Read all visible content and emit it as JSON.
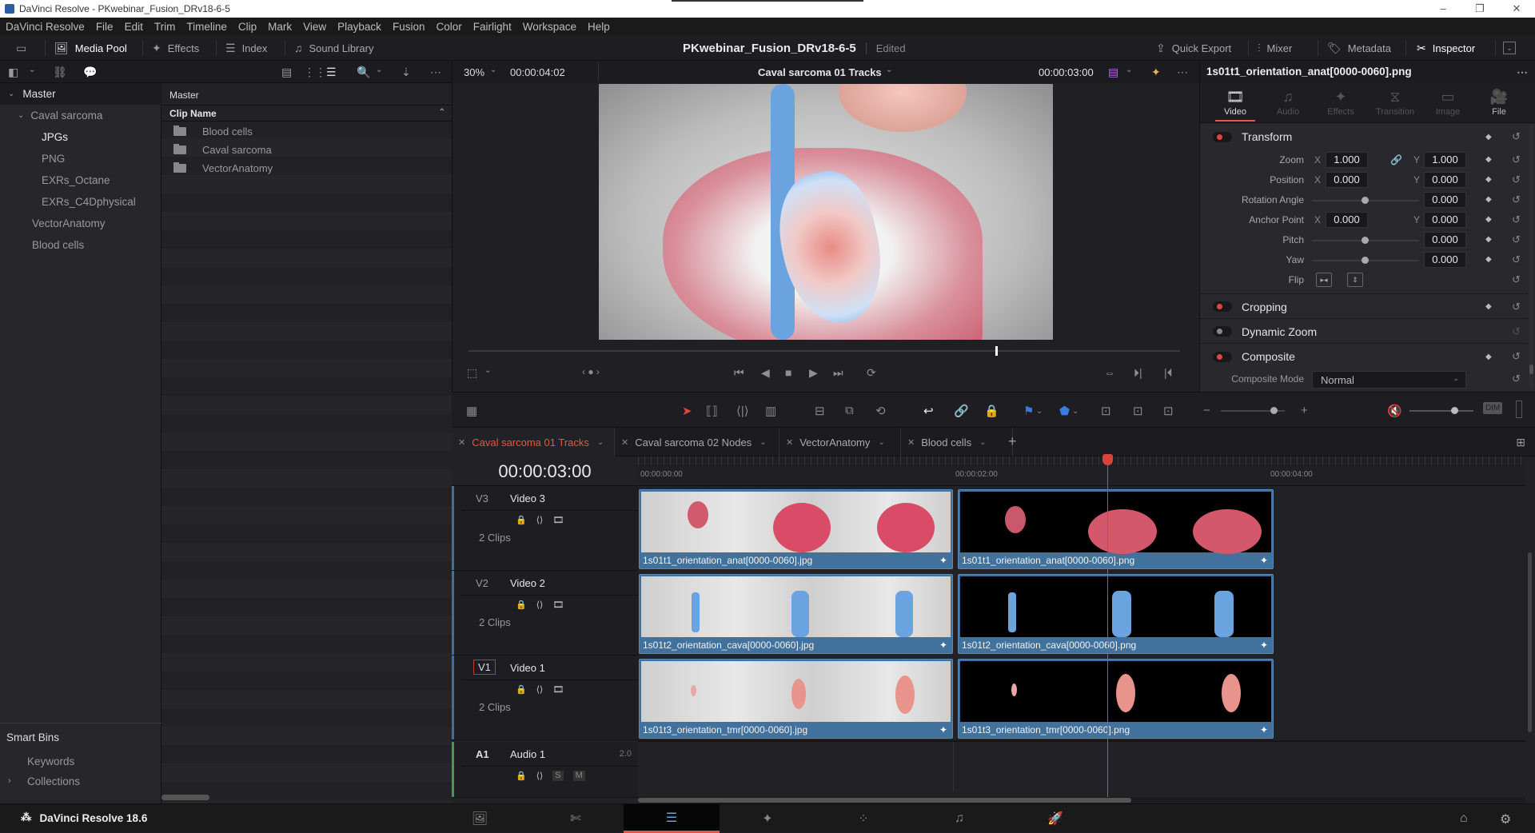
{
  "window": {
    "title": "DaVinci Resolve - PKwebinar_Fusion_DRv18-6-5",
    "controls": [
      "–",
      "❐",
      "✕"
    ]
  },
  "menu": [
    "DaVinci Resolve",
    "File",
    "Edit",
    "Trim",
    "Timeline",
    "Clip",
    "Mark",
    "View",
    "Playback",
    "Fusion",
    "Color",
    "Fairlight",
    "Workspace",
    "Help"
  ],
  "toolbar": {
    "media_pool": "Media Pool",
    "effects": "Effects",
    "index": "Index",
    "sound_library": "Sound Library",
    "project_name": "PKwebinar_Fusion_DRv18-6-5",
    "project_status": "Edited",
    "quick_export": "Quick Export",
    "mixer": "Mixer",
    "metadata": "Metadata",
    "inspector": "Inspector"
  },
  "bins": {
    "master": "Master",
    "items": [
      {
        "label": "Caval sarcoma",
        "level": 1,
        "expanded": true
      },
      {
        "label": "JPGs",
        "level": 2,
        "selected": true
      },
      {
        "label": "PNG",
        "level": 2
      },
      {
        "label": "EXRs_Octane",
        "level": 2
      },
      {
        "label": "EXRs_C4Dphysical",
        "level": 2
      },
      {
        "label": "VectorAnatomy",
        "level": 1
      },
      {
        "label": "Blood cells",
        "level": 1
      }
    ],
    "smart_bins": "Smart Bins",
    "keywords": "Keywords",
    "collections": "Collections"
  },
  "clip_list": {
    "path": "Master",
    "column": "Clip Name",
    "rows": [
      "Blood cells",
      "Caval sarcoma",
      "VectorAnatomy"
    ]
  },
  "viewer": {
    "zoom": "30%",
    "duration": "00:00:04:02",
    "timeline_name": "Caval sarcoma 01 Tracks",
    "timecode": "00:00:03:00",
    "playhead_fraction": 0.74
  },
  "inspector": {
    "clip_name": "1s01t1_orientation_anat[0000-0060].png",
    "tabs": [
      "Video",
      "Audio",
      "Effects",
      "Transition",
      "Image",
      "File"
    ],
    "active_tab": "Video",
    "transform": {
      "title": "Transform",
      "zoom_label": "Zoom",
      "zoom_x": "1.000",
      "zoom_y": "1.000",
      "position_label": "Position",
      "position_x": "0.000",
      "position_y": "0.000",
      "rotation_label": "Rotation Angle",
      "rotation": "0.000",
      "anchor_label": "Anchor Point",
      "anchor_x": "0.000",
      "anchor_y": "0.000",
      "pitch_label": "Pitch",
      "pitch": "0.000",
      "yaw_label": "Yaw",
      "yaw": "0.000",
      "flip_label": "Flip"
    },
    "cropping": "Cropping",
    "dynamic_zoom": "Dynamic Zoom",
    "composite": "Composite",
    "composite_mode_label": "Composite Mode",
    "composite_mode": "Normal",
    "axis_x": "X",
    "axis_y": "Y"
  },
  "timeline": {
    "tabs": [
      {
        "label": "Caval sarcoma 01 Tracks",
        "active": true
      },
      {
        "label": "Caval sarcoma 02 Nodes"
      },
      {
        "label": "VectorAnatomy"
      },
      {
        "label": "Blood cells"
      }
    ],
    "add_tab": "+",
    "timecode": "00:00:03:00",
    "ruler": [
      "00:00:00:00",
      "00:00:02:00",
      "00:00:04:00"
    ],
    "tracks": [
      {
        "id": "V3",
        "name": "Video 3",
        "count": "2 Clips",
        "clips": [
          "1s01t1_orientation_anat[0000-0060].jpg",
          "1s01t1_orientation_anat[0000-0060].png"
        ]
      },
      {
        "id": "V2",
        "name": "Video 2",
        "count": "2 Clips",
        "clips": [
          "1s01t2_orientation_cava[0000-0060].jpg",
          "1s01t2_orientation_cava[0000-0060].png"
        ]
      },
      {
        "id": "V1",
        "name": "Video 1",
        "count": "2 Clips",
        "clips": [
          "1s01t3_orientation_tmr[0000-0060].jpg",
          "1s01t3_orientation_tmr[0000-0060].png"
        ]
      },
      {
        "id": "A1",
        "name": "Audio 1",
        "channels": "2.0",
        "solo": "S",
        "mute": "M"
      }
    ],
    "dim": "DIM"
  },
  "footer": {
    "app": "DaVinci Resolve 18.6",
    "pages": [
      "media",
      "cut",
      "edit",
      "fusion",
      "color",
      "fairlight",
      "deliver"
    ],
    "active_page": "edit"
  },
  "colors": {
    "accent": "#e0564d",
    "clip": "#41719d",
    "playhead": "#d9443a"
  }
}
